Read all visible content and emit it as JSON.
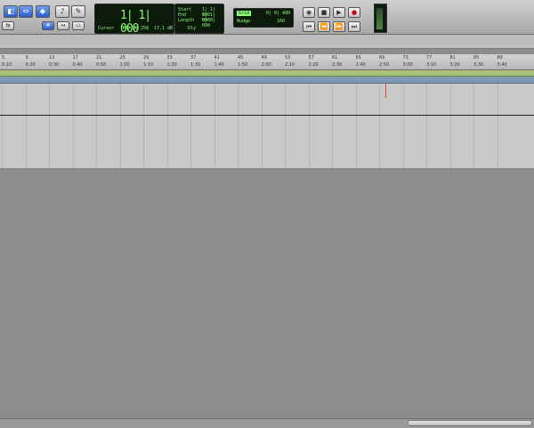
{
  "toolbar": {
    "tools": [
      {
        "name": "zoom-tool",
        "glyph": "⌕",
        "active": true
      },
      {
        "name": "trim-tool",
        "glyph": "⇔",
        "active": true
      },
      {
        "name": "selector-tool",
        "glyph": "I",
        "active": false
      },
      {
        "name": "grabber-tool",
        "glyph": "✋",
        "active": false
      },
      {
        "name": "scrubber-tool",
        "glyph": "🔈",
        "active": false
      },
      {
        "name": "pencil-tool",
        "glyph": "✎",
        "active": false
      }
    ],
    "counter": {
      "main": "1| 1| 000",
      "cursor_label": "Cursor",
      "cursor_value": "70| 3| 258",
      "level_value": "17.1 dB",
      "start_label": "Start",
      "end_label": "End",
      "length_label": "Length",
      "start_value": "1| 1| 000",
      "end_value": "1| 1| 000",
      "length_value": "0| 0| 000",
      "pre_roll": "Dly"
    },
    "grid_nudge": {
      "grid_label": "Grid",
      "grid_value": "0| 0| 480",
      "nudge_label": "Nudge",
      "nudge_value": "160"
    },
    "transport": [
      "online",
      "stop",
      "play",
      "record"
    ]
  },
  "ruler": {
    "bars": [
      "5",
      "9",
      "13",
      "17",
      "21",
      "25",
      "29",
      "33",
      "37",
      "41",
      "45",
      "49",
      "53",
      "57",
      "61",
      "65",
      "69",
      "73",
      "77",
      "81",
      "85",
      "89"
    ],
    "minsecs": [
      "0:10",
      "0:20",
      "0:30",
      "0:40",
      "0:50",
      "1:00",
      "1:10",
      "1:20",
      "1:30",
      "1:40",
      "1:50",
      "2:00",
      "2:10",
      "2:20",
      "2:30",
      "2:40",
      "2:50",
      "3:00",
      "3:10",
      "3:20",
      "3:30",
      "3:40"
    ]
  },
  "colors": {
    "marker": "#a7c27a",
    "tempo": "#7f99b5",
    "playhead": "#e04040"
  }
}
